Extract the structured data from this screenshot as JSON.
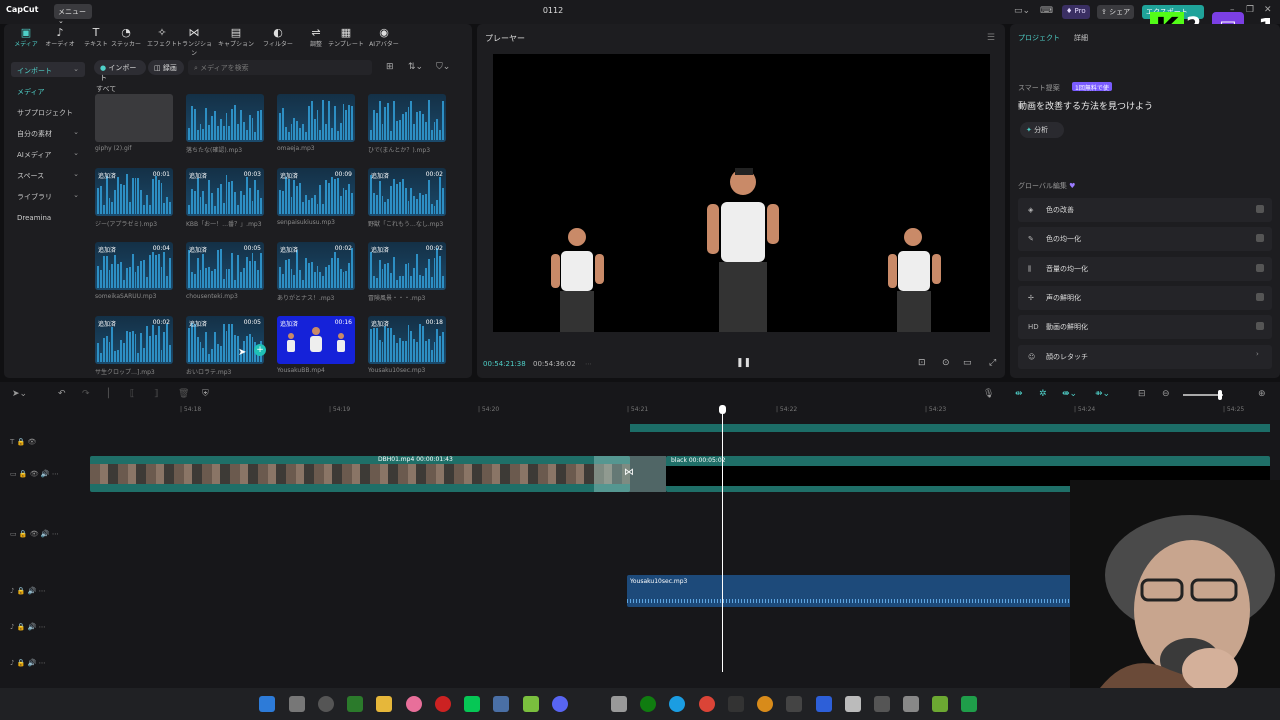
{
  "titlebar": {
    "app_name": "CapCut",
    "menu_label": "メニュー",
    "project_title": "0112",
    "pro_label": "Pro",
    "share_label": "シェア",
    "export_label": "エクスポート"
  },
  "overlay": {
    "kick_count": "2",
    "twitch_count": "1"
  },
  "toolbar": {
    "items": [
      {
        "label": "メディア",
        "icon": "media-icon"
      },
      {
        "label": "オーディオ",
        "icon": "audio-icon"
      },
      {
        "label": "テキスト",
        "icon": "text-icon"
      },
      {
        "label": "ステッカー",
        "icon": "sticker-icon"
      },
      {
        "label": "エフェクト",
        "icon": "effect-icon"
      },
      {
        "label": "トランジション",
        "icon": "transition-icon"
      },
      {
        "label": "キャプション",
        "icon": "caption-icon"
      },
      {
        "label": "フィルター",
        "icon": "filter-icon"
      },
      {
        "label": "調整",
        "icon": "adjust-icon"
      },
      {
        "label": "テンプレート",
        "icon": "template-icon"
      },
      {
        "label": "AIアバター",
        "icon": "ai-avatar-icon"
      }
    ]
  },
  "sidebar": {
    "items": [
      {
        "label": "インポート"
      },
      {
        "label": "メディア"
      },
      {
        "label": "サブプロジェクト"
      },
      {
        "label": "自分の素材"
      },
      {
        "label": "AIメディア"
      },
      {
        "label": "スペース"
      },
      {
        "label": "ライブラリ"
      },
      {
        "label": "Dreamina"
      }
    ]
  },
  "media_toolbar": {
    "import_label": "インポート",
    "record_label": "録画",
    "search_placeholder": "メディアを検索"
  },
  "media": {
    "section_label": "すべて",
    "items": [
      {
        "name": "giphy (2).gif",
        "badge": "",
        "duration": ""
      },
      {
        "name": "落ちたな(確認).mp3",
        "badge": "",
        "duration": ""
      },
      {
        "name": "omaeja.mp3",
        "badge": "",
        "duration": ""
      },
      {
        "name": "ひで(まんとか？).mp3",
        "badge": "",
        "duration": ""
      },
      {
        "name": "ジー(アプラゼミ).mp3",
        "badge": "追加済",
        "duration": "00:01"
      },
      {
        "name": "KBB「お一！…番？」.mp3",
        "badge": "追加済",
        "duration": "00:03"
      },
      {
        "name": "senpaisukiusu.mp3",
        "badge": "追加済",
        "duration": "00:09"
      },
      {
        "name": "野獣「これもう…なし.mp3",
        "badge": "追加済",
        "duration": "00:02"
      },
      {
        "name": "someikaSARUU.mp3",
        "badge": "追加済",
        "duration": "00:04"
      },
      {
        "name": "chousenteki.mp3",
        "badge": "追加済",
        "duration": "00:05"
      },
      {
        "name": "ありがとナス！.mp3",
        "badge": "追加済",
        "duration": "00:02"
      },
      {
        "name": "冒険風景・・・.mp3",
        "badge": "追加済",
        "duration": "00:02"
      },
      {
        "name": "サ生クロップ…].mp3",
        "badge": "追加済",
        "duration": "00:02"
      },
      {
        "name": "おいロラテ.mp3",
        "badge": "追加済",
        "duration": "00:05"
      },
      {
        "name": "YousakuBB.mp4",
        "badge": "追加済",
        "duration": "00:16"
      },
      {
        "name": "Yousaku10sec.mp3",
        "badge": "追加済",
        "duration": "00:18"
      }
    ]
  },
  "player": {
    "title": "プレーヤー",
    "current_time": "00:54:21:38",
    "total_time": "00:54:36:02"
  },
  "right_panel": {
    "tab_project": "プロジェクト",
    "tab_details": "詳細",
    "smart_suggest_label": "スマート提案",
    "smart_badge": "1回無料で使",
    "headline": "動画を改善する方法を見つけよう",
    "analyze_label": "分析",
    "global_edit_label": "グローバル編集",
    "options": [
      {
        "label": "色の改善",
        "icon": "color-improve-icon"
      },
      {
        "label": "色の均一化",
        "icon": "color-match-icon"
      },
      {
        "label": "音量の均一化",
        "icon": "volume-normalize-icon"
      },
      {
        "label": "声の鮮明化",
        "icon": "voice-enhance-icon"
      },
      {
        "label": "動画の鮮明化",
        "icon": "hd-icon"
      },
      {
        "label": "顔のレタッチ",
        "icon": "face-retouch-icon"
      }
    ]
  },
  "timeline": {
    "ruler": [
      "| 54:18",
      "| 54:19",
      "| 54:20",
      "| 54:21",
      "| 54:22",
      "| 54:23",
      "| 54:24",
      "| 54:25"
    ],
    "clip1_label": "DBH01.mp4",
    "clip1_duration": "00:00:01:43",
    "clip2_label": "black",
    "clip2_duration": "00:00:05:02",
    "audio_label": "Yousaku10sec.mp3"
  },
  "colors": {
    "accent": "#4fd0c8",
    "clip": "#1f6f68",
    "audio": "#1d4a7a",
    "pro": "#7a5cff"
  }
}
